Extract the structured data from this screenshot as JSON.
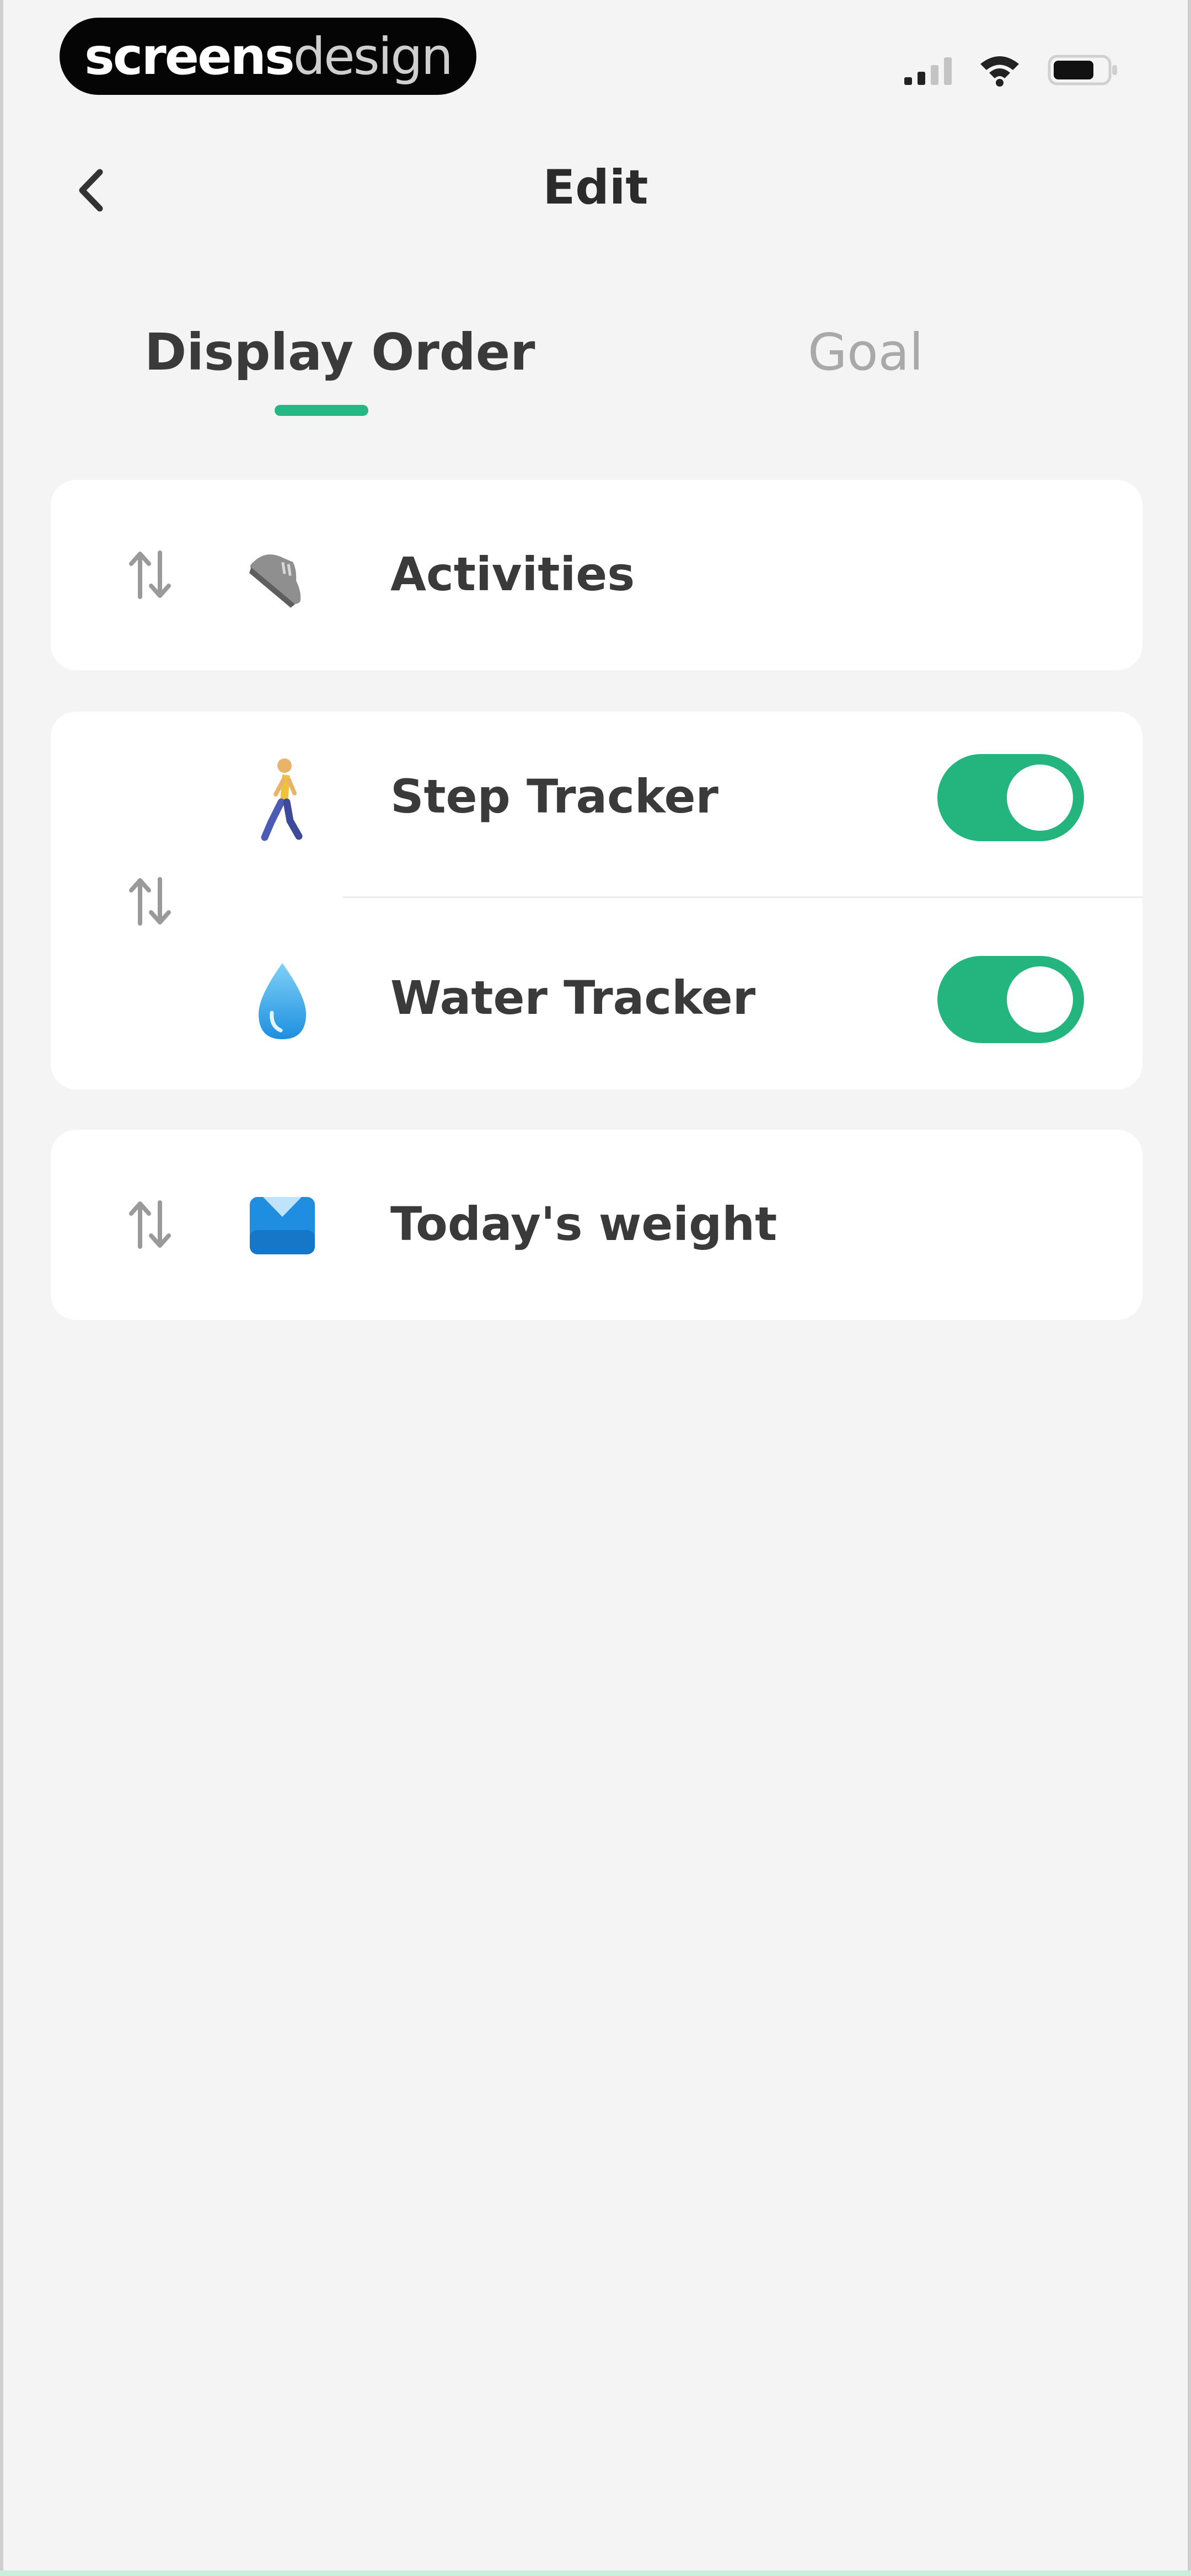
{
  "status_bar": {
    "brand_strong": "screens",
    "brand_light": "design",
    "icons": [
      "signal-icon",
      "wifi-icon",
      "battery-icon"
    ]
  },
  "header": {
    "title": "Edit",
    "back_icon": "chevron-left-icon"
  },
  "tabs": [
    {
      "label": "Display Order",
      "active": true
    },
    {
      "label": "Goal",
      "active": false
    }
  ],
  "list": {
    "drag_icon": "reorder-arrows-icon",
    "items": [
      {
        "label": "Activities",
        "icon": "sneaker-icon"
      },
      {
        "label": "Step Tracker",
        "icon": "walking-person-icon",
        "enabled": true
      },
      {
        "label": "Water Tracker",
        "icon": "water-drop-icon",
        "enabled": true
      },
      {
        "label": "Today's weight",
        "icon": "weight-scale-icon"
      }
    ]
  },
  "colors": {
    "accent": "#23b884",
    "background": "#f4f4f4",
    "card": "#ffffff",
    "toggle_on": "#24b57f"
  }
}
